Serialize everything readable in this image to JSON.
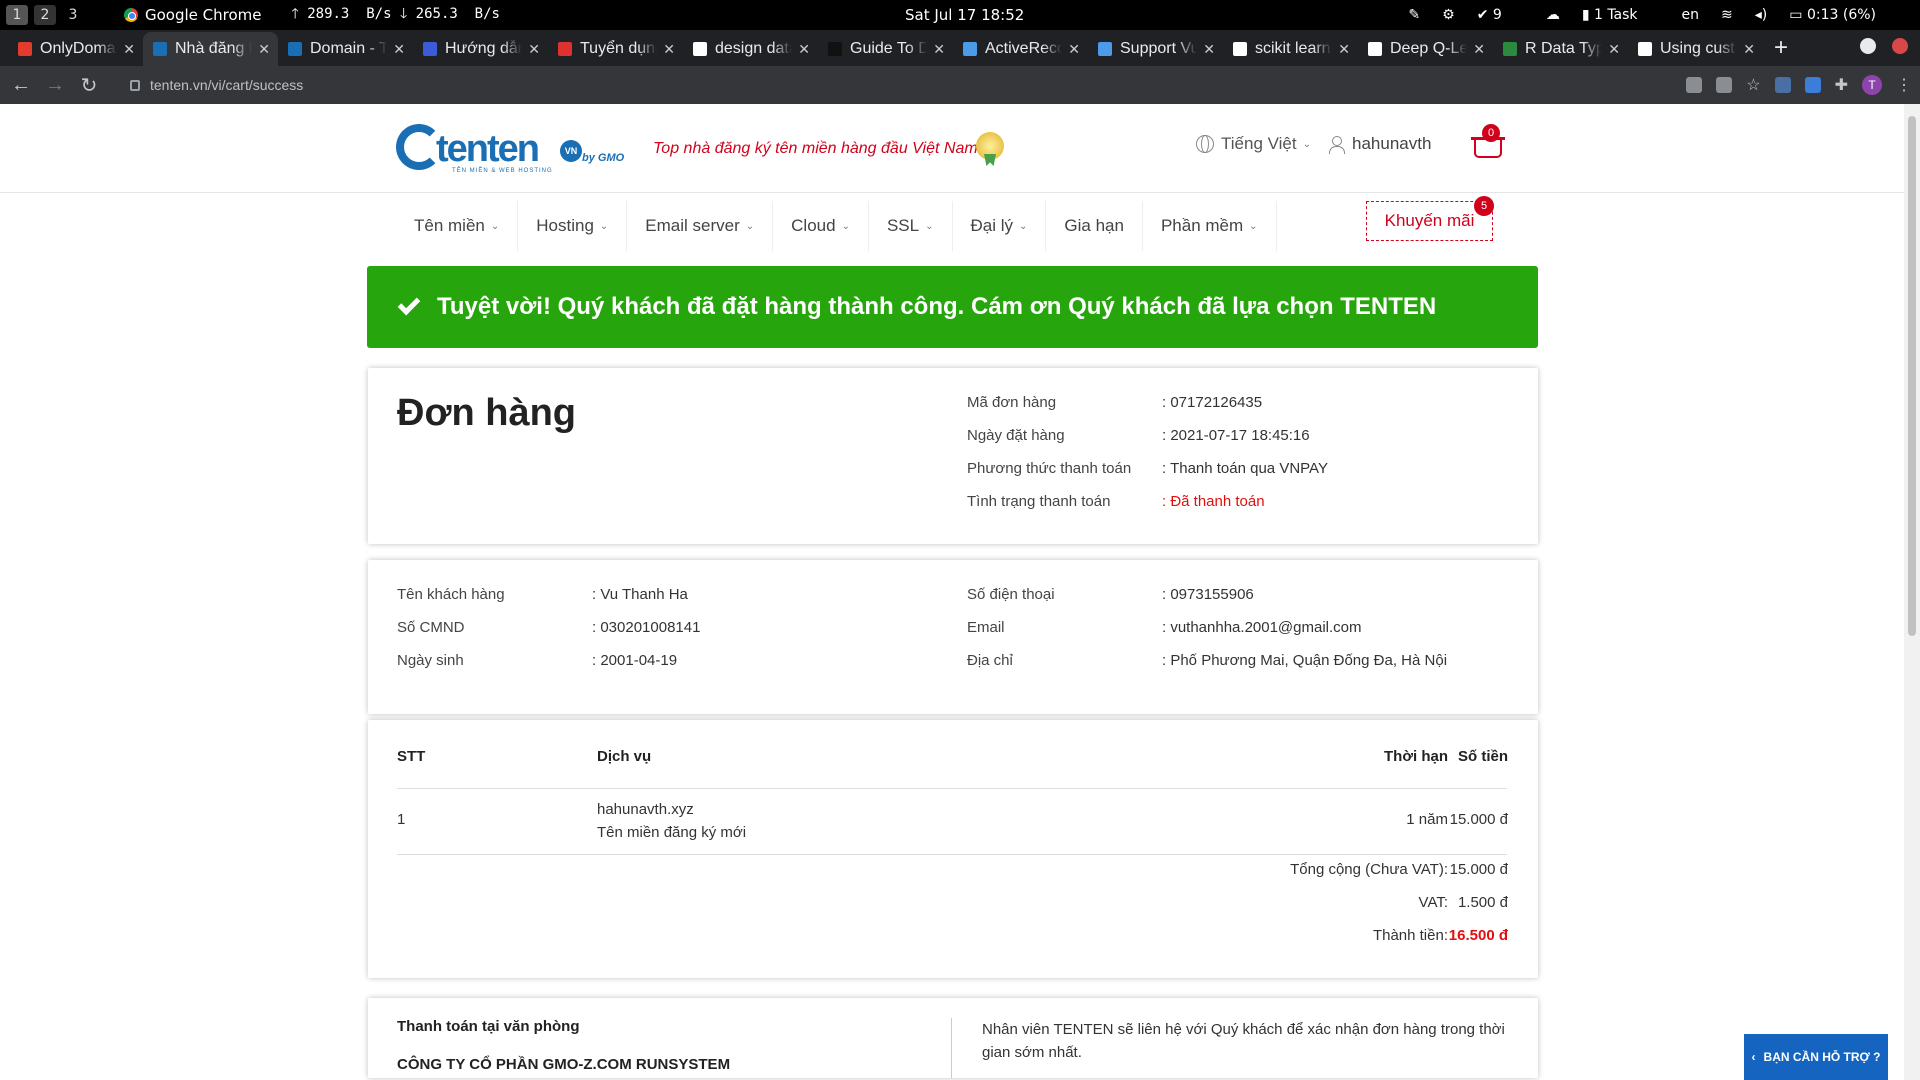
{
  "os_bar": {
    "workspaces": [
      "1",
      "2",
      "3"
    ],
    "app_name": "Google Chrome",
    "net_up": "289.3  B/s",
    "net_down": "265.3  B/s",
    "clock": "Sat Jul 17  18:52",
    "check_count": "9",
    "tasks": "1 Task",
    "lang": "en",
    "battery": "0:13 (6%)"
  },
  "tabs": [
    {
      "title": "OnlyDomains",
      "icon": "opera-icon",
      "color": "#e33b2e"
    },
    {
      "title": "Nhà đăng ký",
      "icon": "tenten-icon",
      "color": "#1a6fb4"
    },
    {
      "title": "Domain - Ten",
      "icon": "tenten-icon",
      "color": "#1a6fb4"
    },
    {
      "title": "Hướng dẫn",
      "icon": "doc-icon",
      "color": "#3b5bdb"
    },
    {
      "title": "Tuyển dụng",
      "icon": "it-icon",
      "color": "#e03131"
    },
    {
      "title": "design data",
      "icon": "google-icon",
      "color": "#ffffff"
    },
    {
      "title": "Guide To D",
      "icon": "guide-icon",
      "color": "#111111"
    },
    {
      "title": "ActiveRecor",
      "icon": "v-icon",
      "color": "#4c9be8"
    },
    {
      "title": "Support Vue",
      "icon": "v-icon",
      "color": "#4c9be8"
    },
    {
      "title": "scikit learn",
      "icon": "google-icon",
      "color": "#ffffff"
    },
    {
      "title": "Deep Q-Lea",
      "icon": "chart-icon",
      "color": "#ffffff"
    },
    {
      "title": "R Data Type",
      "icon": "w-icon",
      "color": "#2b8a3e"
    },
    {
      "title": "Using cust",
      "icon": "medium-icon",
      "color": "#ffffff"
    }
  ],
  "address_bar": {
    "url": "tenten.vn/vi/cart/success",
    "profile_initial": "T"
  },
  "site": {
    "logo_text": "tenten",
    "logo_vn": "VN",
    "logo_gmo": "by GMO",
    "logo_sub": "TÊN MIỀN & WEB HOSTING",
    "tagline": "Top nhà đăng ký tên miền hàng đầu Việt Nam",
    "language": "Tiếng Việt",
    "username": "hahunavth",
    "cart_count": "0",
    "nav": [
      "Tên miền",
      "Hosting",
      "Email server",
      "Cloud",
      "SSL",
      "Đại lý",
      "Gia hạn",
      "Phần mềm"
    ],
    "nav_has_caret": [
      true,
      true,
      true,
      true,
      true,
      true,
      false,
      true
    ],
    "promo_label": "Khuyến mãi",
    "promo_count": "5"
  },
  "success_message": "Tuyệt vời! Quý khách đã đặt hàng thành công. Cám ơn Quý khách đã lựa chọn TENTEN",
  "order": {
    "title": "Đơn hàng",
    "fields": [
      {
        "label": "Mã đơn hàng",
        "value": ": 07172126435"
      },
      {
        "label": "Ngày đặt hàng",
        "value": ": 2021-07-17 18:45:16"
      },
      {
        "label": "Phương thức thanh toán",
        "value": ": Thanh toán qua VNPAY"
      },
      {
        "label": "Tình trạng thanh toán",
        "value": ": Đã thanh toán"
      }
    ]
  },
  "customer": {
    "left": [
      {
        "label": "Tên khách hàng",
        "value": ": Vu Thanh Ha"
      },
      {
        "label": "Số CMND",
        "value": ": 030201008141"
      },
      {
        "label": "Ngày sinh",
        "value": ": 2001-04-19"
      }
    ],
    "right": [
      {
        "label": "Số điện thoại",
        "value": ": 0973155906"
      },
      {
        "label": "Email",
        "value": ": vuthanhha.2001@gmail.com"
      },
      {
        "label": "Địa chỉ",
        "value": ": Phố Phương Mai, Quận Đống Đa, Hà Nội"
      }
    ]
  },
  "items": {
    "headers": {
      "stt": "STT",
      "service": "Dịch vụ",
      "term": "Thời hạn",
      "amount": "Số tiền"
    },
    "rows": [
      {
        "stt": "1",
        "service_name": "hahunavth.xyz",
        "service_desc": "Tên miền đăng ký mới",
        "term": "1 năm",
        "amount": "15.000 đ"
      }
    ],
    "subtotal_label": "Tổng cộng (Chưa VAT):",
    "subtotal": "15.000 đ",
    "vat_label": "VAT:",
    "vat": "1.500 đ",
    "total_label": "Thành tiền:",
    "total": "16.500 đ"
  },
  "payment": {
    "left_title": "Thanh toán tại văn phòng",
    "company": "CÔNG TY CỔ PHẦN GMO-Z.COM RUNSYSTEM",
    "right_text": "Nhân viên TENTEN sẽ liên hệ với Quý khách để xác nhận đơn hàng trong thời gian sớm nhất."
  },
  "support_button": "BẠN CẦN HỖ TRỢ ?",
  "colors": {
    "success_green": "#27a50c",
    "brand_blue": "#1a6fb4",
    "accent_red": "#e01010"
  }
}
